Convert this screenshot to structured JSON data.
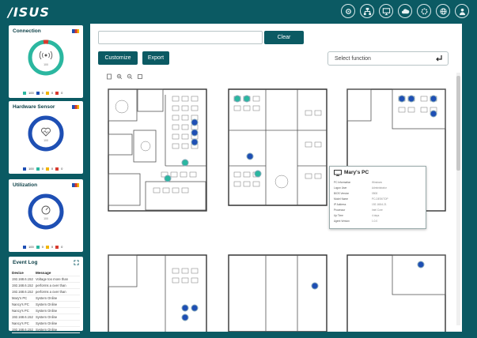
{
  "header": {
    "logo": "/ISUS"
  },
  "top_icons": [
    "gear-icon",
    "network-icon",
    "monitor-icon",
    "cloud-icon",
    "settings-icon",
    "globe-icon",
    "user-icon"
  ],
  "sidebar": {
    "connection": {
      "title": "Connection",
      "center_label": "100",
      "ring_color": "#2bb7a0"
    },
    "hardware": {
      "title": "Hardware Sensor",
      "center_label": "100",
      "ring_color": "#1e4fb4"
    },
    "utilization": {
      "title": "Utilization",
      "center_label": "100",
      "ring_color": "#1e4fb4"
    },
    "legend": [
      "100",
      "0",
      "0",
      "0"
    ],
    "event_log": {
      "title": "Event Log",
      "headers": [
        "Device",
        "Message"
      ],
      "rows": [
        [
          "192.168.6.152",
          "Voltage too more than"
        ],
        [
          "192.168.6.152",
          "performs a over than"
        ],
        [
          "192.168.6.152",
          "performs a over than"
        ],
        [
          "Mary's PC",
          "System Online"
        ],
        [
          "Nancy's PC",
          "System Online"
        ],
        [
          "Nancy's PC",
          "System Online"
        ],
        [
          "192.168.6.152",
          "System Online"
        ],
        [
          "Nancy's PC",
          "System Online"
        ],
        [
          "192.168.6.152",
          "System Online"
        ],
        [
          "192.168.6.152",
          "System Online"
        ]
      ]
    }
  },
  "toolbar": {
    "search_value": "",
    "clear_label": "Clear",
    "customize_label": "Customize",
    "export_label": "Export",
    "select_placeholder": "Select function"
  },
  "popup": {
    "title": "Mary's PC",
    "rows": [
      [
        "PC Information",
        "Windows"
      ],
      [
        "Logon User",
        "Administrator"
      ],
      [
        "BIOS Version",
        "0508"
      ],
      [
        "Model Name",
        "PC-DESKTOP"
      ],
      [
        "IP Address",
        "192.168.6.21"
      ],
      [
        "Processor",
        "Intel Core"
      ],
      [
        "Up Time",
        "4 days"
      ],
      [
        "Agent Version",
        "1.0.0"
      ]
    ]
  },
  "colors": {
    "brand": "#0b5a63",
    "ok": "#2bb7a0",
    "device": "#1e4fb4"
  }
}
